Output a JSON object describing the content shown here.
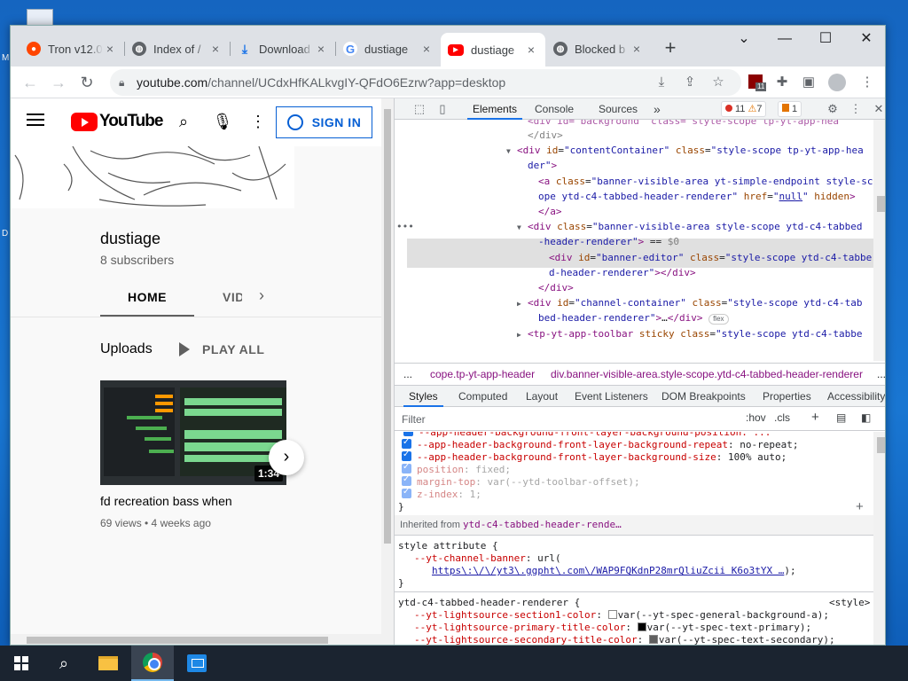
{
  "desktop": {
    "letters": [
      "M",
      "D"
    ]
  },
  "tabs": [
    {
      "title": "Tron v12.0",
      "fav_color": "#ff4500",
      "fav_char": "r"
    },
    {
      "title": "Index of /",
      "fav_color": "#5f6368",
      "fav_char": "🌐"
    },
    {
      "title": "Download",
      "fav_color": "#1a73e8",
      "fav_char": "↓"
    },
    {
      "title": "dustiage",
      "fav_color": "#4285f4",
      "fav_char": "G"
    },
    {
      "title": "dustiage",
      "fav_color": "#ff0000",
      "fav_char": "▶"
    },
    {
      "title": "Blocked b",
      "fav_color": "#5f6368",
      "fav_char": "🌐"
    }
  ],
  "toolbar": {
    "url_host": "youtube.com",
    "url_path": "/channel/UCdxHfKALkvgIY-QFdO6Ezrw?app=desktop",
    "ext_badge": "11"
  },
  "youtube": {
    "logo_text": "YouTube",
    "signin_label": "SIGN IN",
    "channel_name": "dustiage",
    "subscribers": "8 subscribers",
    "tab_home": "HOME",
    "tab_videos": "VIDE",
    "uploads_label": "Uploads",
    "play_all_label": "PLAY ALL",
    "video": {
      "duration": "1:34",
      "title": "fd recreation bass when",
      "meta": "69 views • 4 weeks ago"
    }
  },
  "devtools": {
    "tabs": [
      "Elements",
      "Console",
      "Sources"
    ],
    "more": "»",
    "errors": "11",
    "warnings": "7",
    "issues": "1",
    "dom_lines": [
      {
        "indent": 150,
        "arrow": "",
        "html": "<span class='gray'>&lt;/div&gt;</span>"
      },
      {
        "indent": 138,
        "arrow": "▼",
        "html": "<span class='tagc'>&lt;div</span> <span class='attrn'>id</span>=<span class='attrv'>\"contentContainer\"</span> <span class='attrn'>class</span>=<span class='attrv'>\"style-scope tp-yt-app-hea</span>"
      },
      {
        "indent": 150,
        "arrow": "",
        "html": "<span class='attrv'>der\"</span><span class='tagc'>&gt;</span>"
      },
      {
        "indent": 162,
        "arrow": "",
        "html": "<span class='tagc'>&lt;a</span> <span class='attrn'>class</span>=<span class='attrv'>\"banner-visible-area yt-simple-endpoint style-sc</span>"
      },
      {
        "indent": 162,
        "arrow": "",
        "html": "<span class='attrv'>ope ytd-c4-tabbed-header-renderer\"</span> <span class='attrn'>href</span>=<span class='attrv'>\"<span class='lnk'>null</span>\"</span> <span class='attrn'>hidden</span><span class='tagc'>&gt;</span>"
      },
      {
        "indent": 162,
        "arrow": "",
        "html": "<span class='tagc'>&lt;/a&gt;</span>"
      },
      {
        "indent": 150,
        "arrow": "▼",
        "html": "<span class='tagc'>&lt;div</span> <span class='attrn'>class</span>=<span class='attrv'>\"banner-visible-area style-scope ytd-c4-tabbed</span>"
      },
      {
        "indent": 162,
        "arrow": "",
        "html": "<span class='attrv'>-header-renderer\"</span><span class='tagc'>&gt;</span> == <span class='gray'>$0</span>"
      },
      {
        "indent": 174,
        "arrow": "",
        "html": "<span class='tagc'>&lt;div</span> <span class='attrn'>id</span>=<span class='attrv'>\"banner-editor\"</span> <span class='attrn'>class</span>=<span class='attrv'>\"style-scope ytd-c4-tabbe</span>"
      },
      {
        "indent": 174,
        "arrow": "",
        "html": "<span class='attrv'>d-header-renderer\"</span><span class='tagc'>&gt;&lt;/div&gt;</span>"
      },
      {
        "indent": 162,
        "arrow": "",
        "html": "<span class='tagc'>&lt;/div&gt;</span>"
      },
      {
        "indent": 150,
        "arrow": "▶",
        "html": "<span class='tagc'>&lt;div</span> <span class='attrn'>id</span>=<span class='attrv'>\"channel-container\"</span> <span class='attrn'>class</span>=<span class='attrv'>\"style-scope ytd-c4-tab</span>"
      },
      {
        "indent": 162,
        "arrow": "",
        "html": "<span class='attrv'>bed-header-renderer\"</span><span class='tagc'>&gt;</span>…<span class='tagc'>&lt;/div&gt;</span> <span class='flexbadge'>flex</span>"
      },
      {
        "indent": 150,
        "arrow": "▶",
        "html": "<span class='tagc'>&lt;tp-yt-app-toolbar</span> <span class='attrn'>sticky</span> <span class='attrn'>class</span>=<span class='attrv'>\"style-scope ytd-c4-tabbe</span>"
      }
    ],
    "breadcrumbs": [
      "...",
      "cope.tp-yt-app-header",
      "div.banner-visible-area.style-scope.ytd-c4-tabbed-header-renderer",
      "..."
    ],
    "subtabs": [
      "Styles",
      "Computed",
      "Layout",
      "Event Listeners",
      "DOM Breakpoints",
      "Properties",
      "Accessibility"
    ],
    "filter_placeholder": "Filter",
    "hov": ":hov",
    "cls": ".cls",
    "inherited_from_label": "Inherited from",
    "inherited_from_value": "ytd-c4-tabbed-header-rende…",
    "style_attr": "style attribute {",
    "banner_var": "--yt-channel-banner",
    "banner_url": "https\\:\\/\\/yt3\\.ggpht\\.com\\/WAP9FQKdnP28mrQliuZcii K6o3tYX …",
    "selector": "ytd-c4-tabbed-header-renderer {",
    "source": "<style>"
  },
  "taskbar": {
    "items": [
      "start",
      "search",
      "explorer",
      "chrome",
      "app"
    ]
  }
}
